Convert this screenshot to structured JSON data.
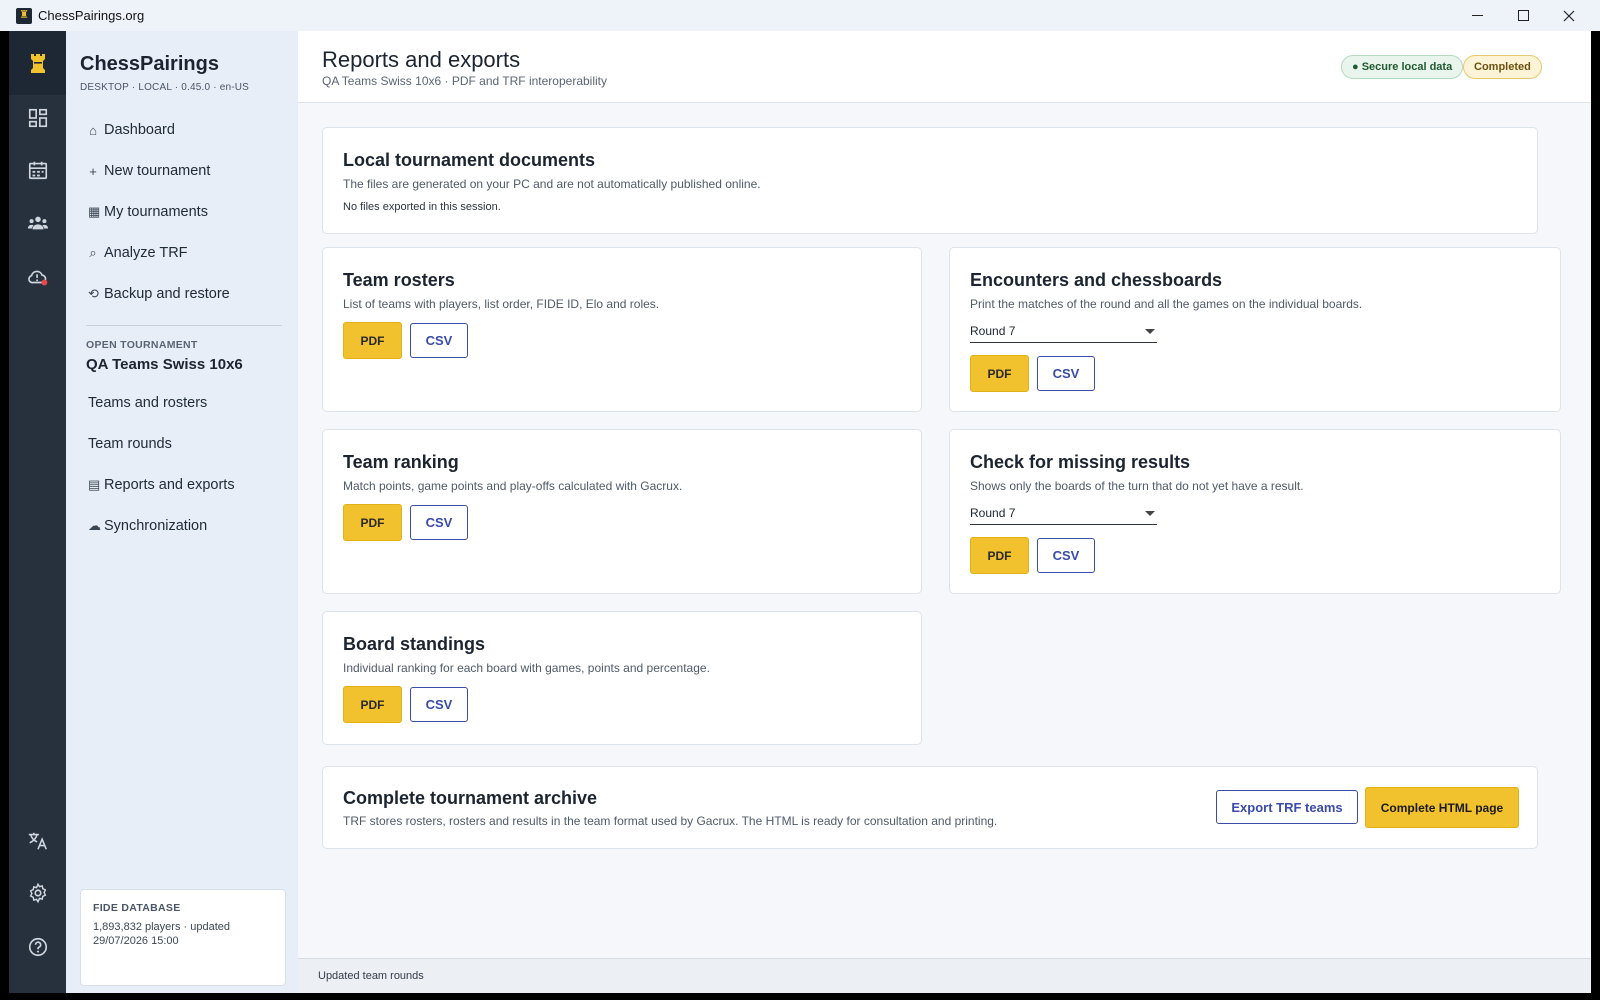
{
  "window": {
    "title": "ChessPairings.org",
    "minimize_glyph": "—",
    "maximize_glyph": "☐",
    "close_glyph": "✕"
  },
  "rail": {
    "icons": [
      "rook-icon",
      "dashboard-icon",
      "calendar-icon",
      "users-icon",
      "cloud-alert-icon",
      "translate-icon",
      "settings-gear-icon",
      "help-icon"
    ],
    "logo_glyph": "♜",
    "colors": {
      "background": "#27313d",
      "logo": "#f2c12e",
      "alert_dot": "#e5484d"
    }
  },
  "sidebar": {
    "app_name": "ChessPairings",
    "app_meta": "DESKTOP · LOCAL · 0.45.0 · en-US",
    "nav": [
      {
        "glyph": "⌂",
        "label": "Dashboard"
      },
      {
        "glyph": "+",
        "label": "New tournament"
      },
      {
        "glyph": "▦",
        "label": "My tournaments"
      },
      {
        "glyph": "⌕",
        "label": "Analyze TRF"
      },
      {
        "glyph": "⟲",
        "label": "Backup and restore"
      }
    ],
    "open_tournament_label": "OPEN TOURNAMENT",
    "open_tournament_name": "QA Teams Swiss 10x6",
    "tournament_nav": [
      {
        "glyph": "",
        "label": "Teams and rosters"
      },
      {
        "glyph": "",
        "label": "Team rounds"
      },
      {
        "glyph": "▤",
        "label": "Reports and exports"
      },
      {
        "glyph": "☁",
        "label": "Synchronization"
      }
    ],
    "fide": {
      "label": "FIDE DATABASE",
      "value": "1,893,832 players · updated 29/07/2026 15:00"
    }
  },
  "header": {
    "title": "Reports and exports",
    "subtitle": "QA Teams Swiss 10x6 · PDF and TRF interoperability",
    "badge_secure": "● Secure local data",
    "badge_status": "Completed"
  },
  "local_docs": {
    "title": "Local tournament documents",
    "description": "The files are generated on your PC and are not automatically published online.",
    "note": "No files exported in this session."
  },
  "cards": {
    "rosters": {
      "title": "Team rosters",
      "description": "List of teams with players, list order, FIDE ID, Elo and roles.",
      "pdf": "PDF",
      "csv": "CSV"
    },
    "encounters": {
      "title": "Encounters and chessboards",
      "description": "Print the matches of the round and all the games on the individual boards.",
      "round": "Round 7",
      "pdf": "PDF",
      "csv": "CSV"
    },
    "ranking": {
      "title": "Team ranking",
      "description": "Match points, game points and play-offs calculated with Gacrux.",
      "pdf": "PDF",
      "csv": "CSV"
    },
    "missing": {
      "title": "Check for missing results",
      "description": "Shows only the boards of the turn that do not yet have a result.",
      "round": "Round 7",
      "pdf": "PDF",
      "csv": "CSV"
    },
    "boards": {
      "title": "Board standings",
      "description": "Individual ranking for each board with games, points and percentage.",
      "pdf": "PDF",
      "csv": "CSV"
    }
  },
  "archive": {
    "title": "Complete tournament archive",
    "description": "TRF stores rosters, rosters and results in the team format used by Gacrux. The HTML is ready for consultation and printing.",
    "export_trf": "Export TRF teams",
    "html_page": "Complete HTML page"
  },
  "status": {
    "text": "Updated team rounds"
  },
  "colors": {
    "accent_yellow": "#f2c12e",
    "accent_blue": "#3a4ba8",
    "sidebar_bg": "#e8eef7"
  }
}
